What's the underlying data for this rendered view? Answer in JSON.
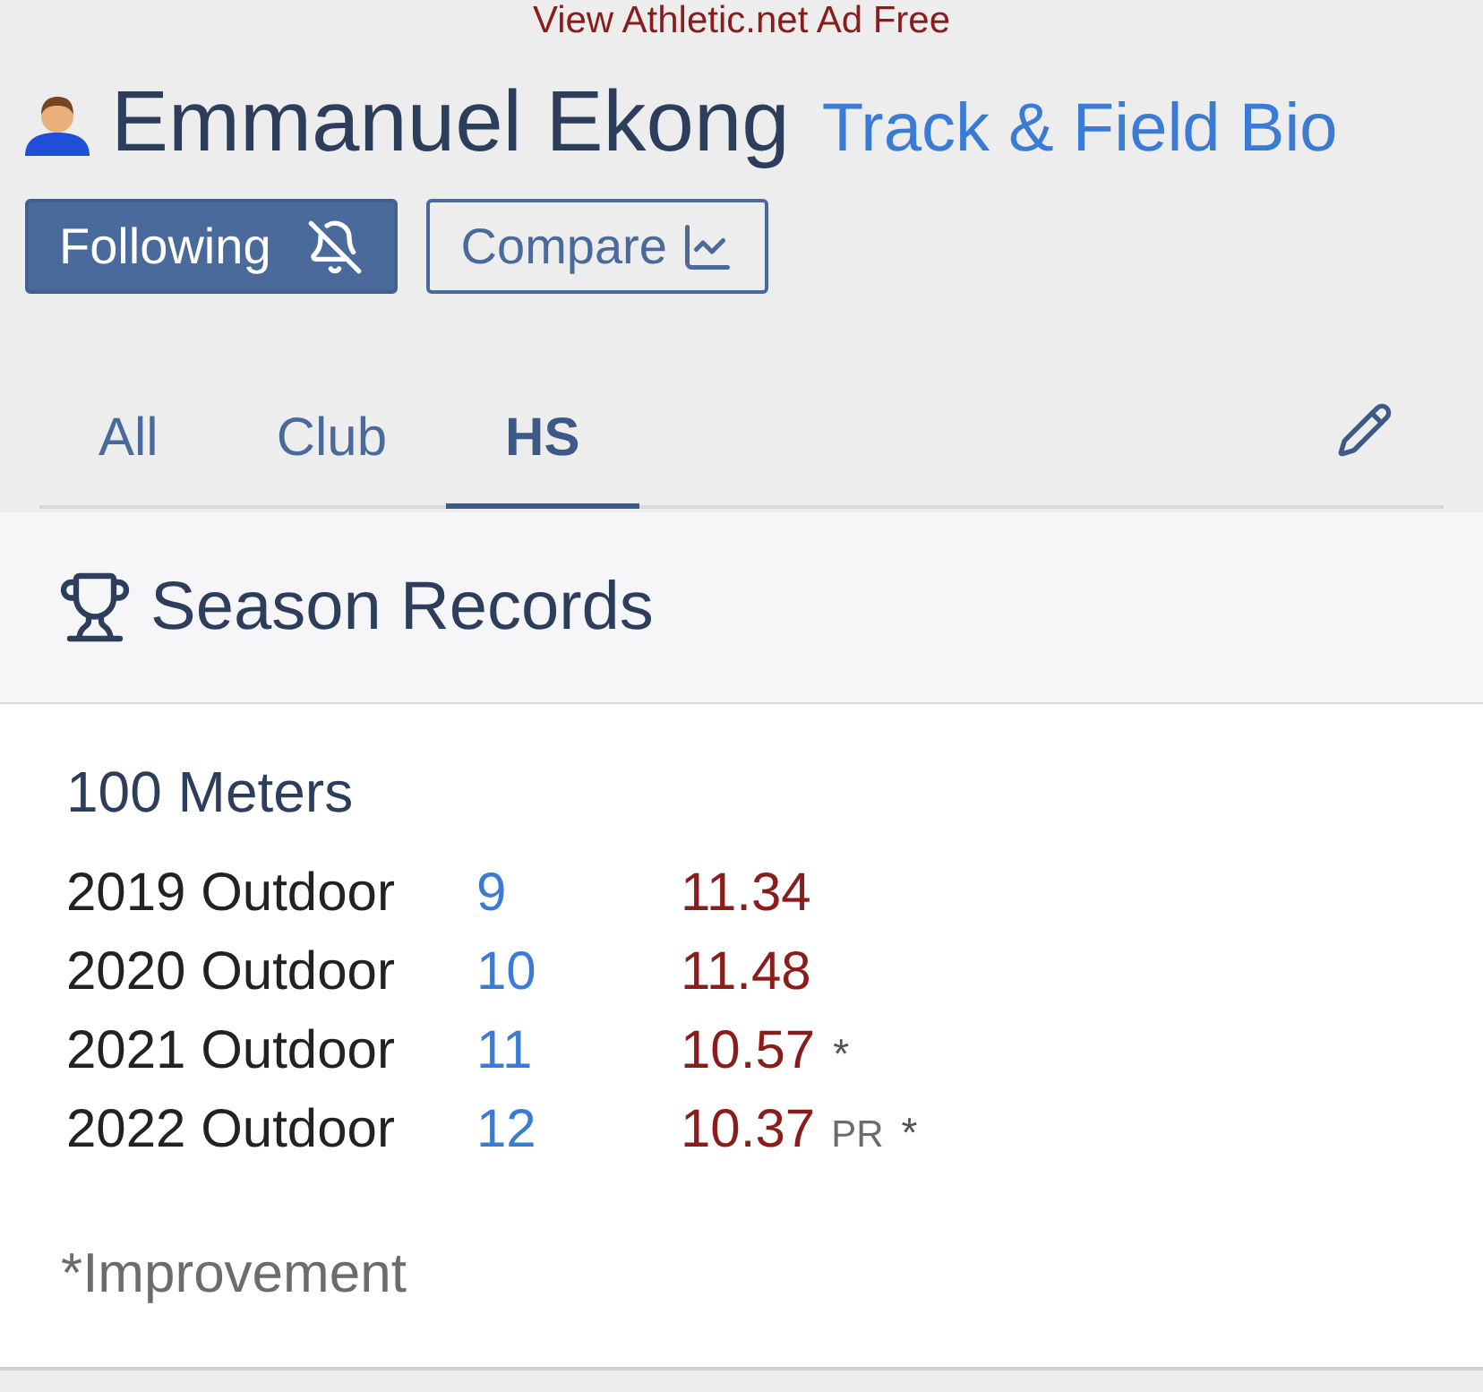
{
  "ad_link": "View Athletic.net Ad Free",
  "athlete": {
    "name": "Emmanuel Ekong",
    "bio_link": "Track & Field Bio"
  },
  "buttons": [
    {
      "kind": "follow",
      "label": "Following"
    },
    {
      "kind": "compare",
      "label": "Compare"
    }
  ],
  "tabs": [
    {
      "label": "All",
      "selected": false
    },
    {
      "label": "Club",
      "selected": false
    },
    {
      "label": "HS",
      "selected": true
    }
  ],
  "section": {
    "title": "Season Records",
    "events": [
      {
        "name": "100 Meters",
        "rows": [
          {
            "season": "2019 Outdoor",
            "grade": "9",
            "mark": "11.34"
          },
          {
            "season": "2020 Outdoor",
            "grade": "10",
            "mark": "11.48"
          },
          {
            "season": "2021 Outdoor",
            "grade": "11",
            "mark": "10.57",
            "improvement": "*"
          },
          {
            "season": "2022 Outdoor",
            "grade": "12",
            "mark": "10.37",
            "pr": "PR",
            "improvement": "*"
          }
        ]
      }
    ],
    "footnote": "*Improvement"
  }
}
